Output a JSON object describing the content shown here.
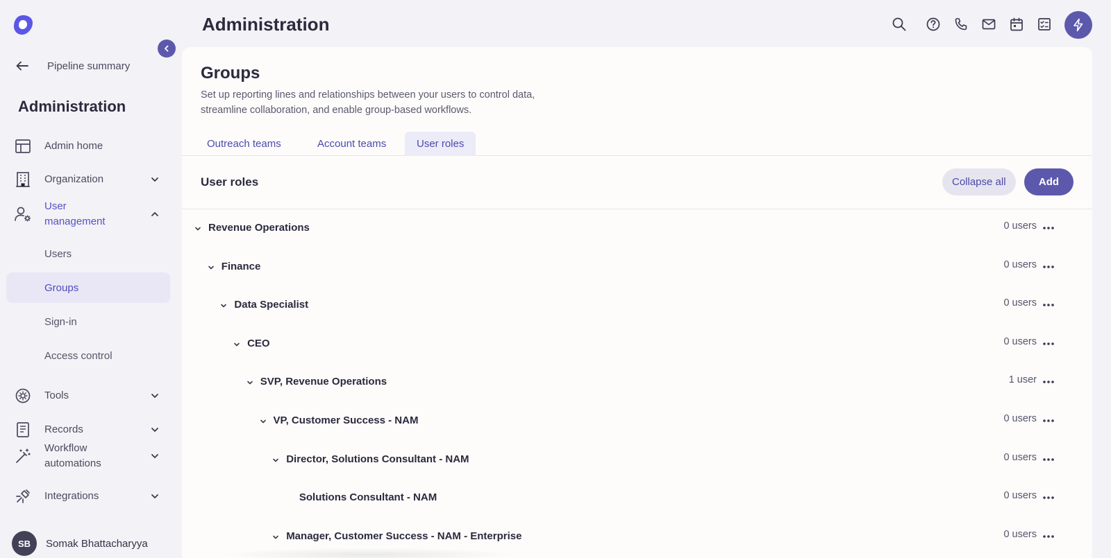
{
  "sidebar": {
    "back_label": "Pipeline summary",
    "title": "Administration",
    "items": [
      {
        "label": "Admin home",
        "icon": "layout-icon",
        "expandable": false
      },
      {
        "label": "Organization",
        "icon": "building-icon",
        "expandable": true
      },
      {
        "label": "User management",
        "icon": "user-gear-icon",
        "expandable": true,
        "expanded": true
      },
      {
        "label": "Tools",
        "icon": "tools-icon",
        "expandable": true
      },
      {
        "label": "Records",
        "icon": "records-icon",
        "expandable": true
      },
      {
        "label": "Workflow automations",
        "icon": "magic-wand-icon",
        "expandable": true
      },
      {
        "label": "Integrations",
        "icon": "plug-icon",
        "expandable": true
      }
    ],
    "sub_items": [
      {
        "label": "Users"
      },
      {
        "label": "Groups",
        "selected": true
      },
      {
        "label": "Sign-in"
      },
      {
        "label": "Access control"
      }
    ],
    "user": {
      "initials": "SB",
      "name": "Somak Bhattacharyya"
    }
  },
  "header": {
    "title": "Administration",
    "icons": [
      "search-icon",
      "help-icon",
      "phone-icon",
      "mail-icon",
      "calendar-icon",
      "task-icon",
      "bolt-icon"
    ]
  },
  "main": {
    "title": "Groups",
    "description": "Set up reporting lines and relationships between your users to control data, streamline collaboration, and enable group-based workflows.",
    "tabs": [
      {
        "label": "Outreach teams"
      },
      {
        "label": "Account teams"
      },
      {
        "label": "User roles",
        "active": true
      }
    ],
    "section_title": "User roles",
    "collapse_all_label": "Collapse all",
    "add_label": "Add",
    "roles": [
      {
        "name": "Revenue Operations",
        "count": "0 users",
        "depth": 0,
        "has_children": true
      },
      {
        "name": "Finance",
        "count": "0 users",
        "depth": 1,
        "has_children": true
      },
      {
        "name": "Data Specialist",
        "count": "0 users",
        "depth": 2,
        "has_children": true
      },
      {
        "name": "CEO",
        "count": "0 users",
        "depth": 3,
        "has_children": true
      },
      {
        "name": "SVP, Revenue Operations",
        "count": "1 user",
        "depth": 4,
        "has_children": true
      },
      {
        "name": "VP, Customer Success - NAM",
        "count": "0 users",
        "depth": 5,
        "has_children": true
      },
      {
        "name": "Director, Solutions Consultant - NAM",
        "count": "0 users",
        "depth": 6,
        "has_children": true
      },
      {
        "name": "Solutions Consultant - NAM",
        "count": "0 users",
        "depth": 7,
        "has_children": false
      },
      {
        "name": "Manager, Customer Success - NAM - Enterprise",
        "count": "0 users",
        "depth": 6,
        "has_children": true
      }
    ]
  },
  "colors": {
    "accent": "#5c59ad",
    "accent_text": "#4d4aad",
    "background": "#f3f2f6",
    "panel": "#fdfcfb"
  }
}
